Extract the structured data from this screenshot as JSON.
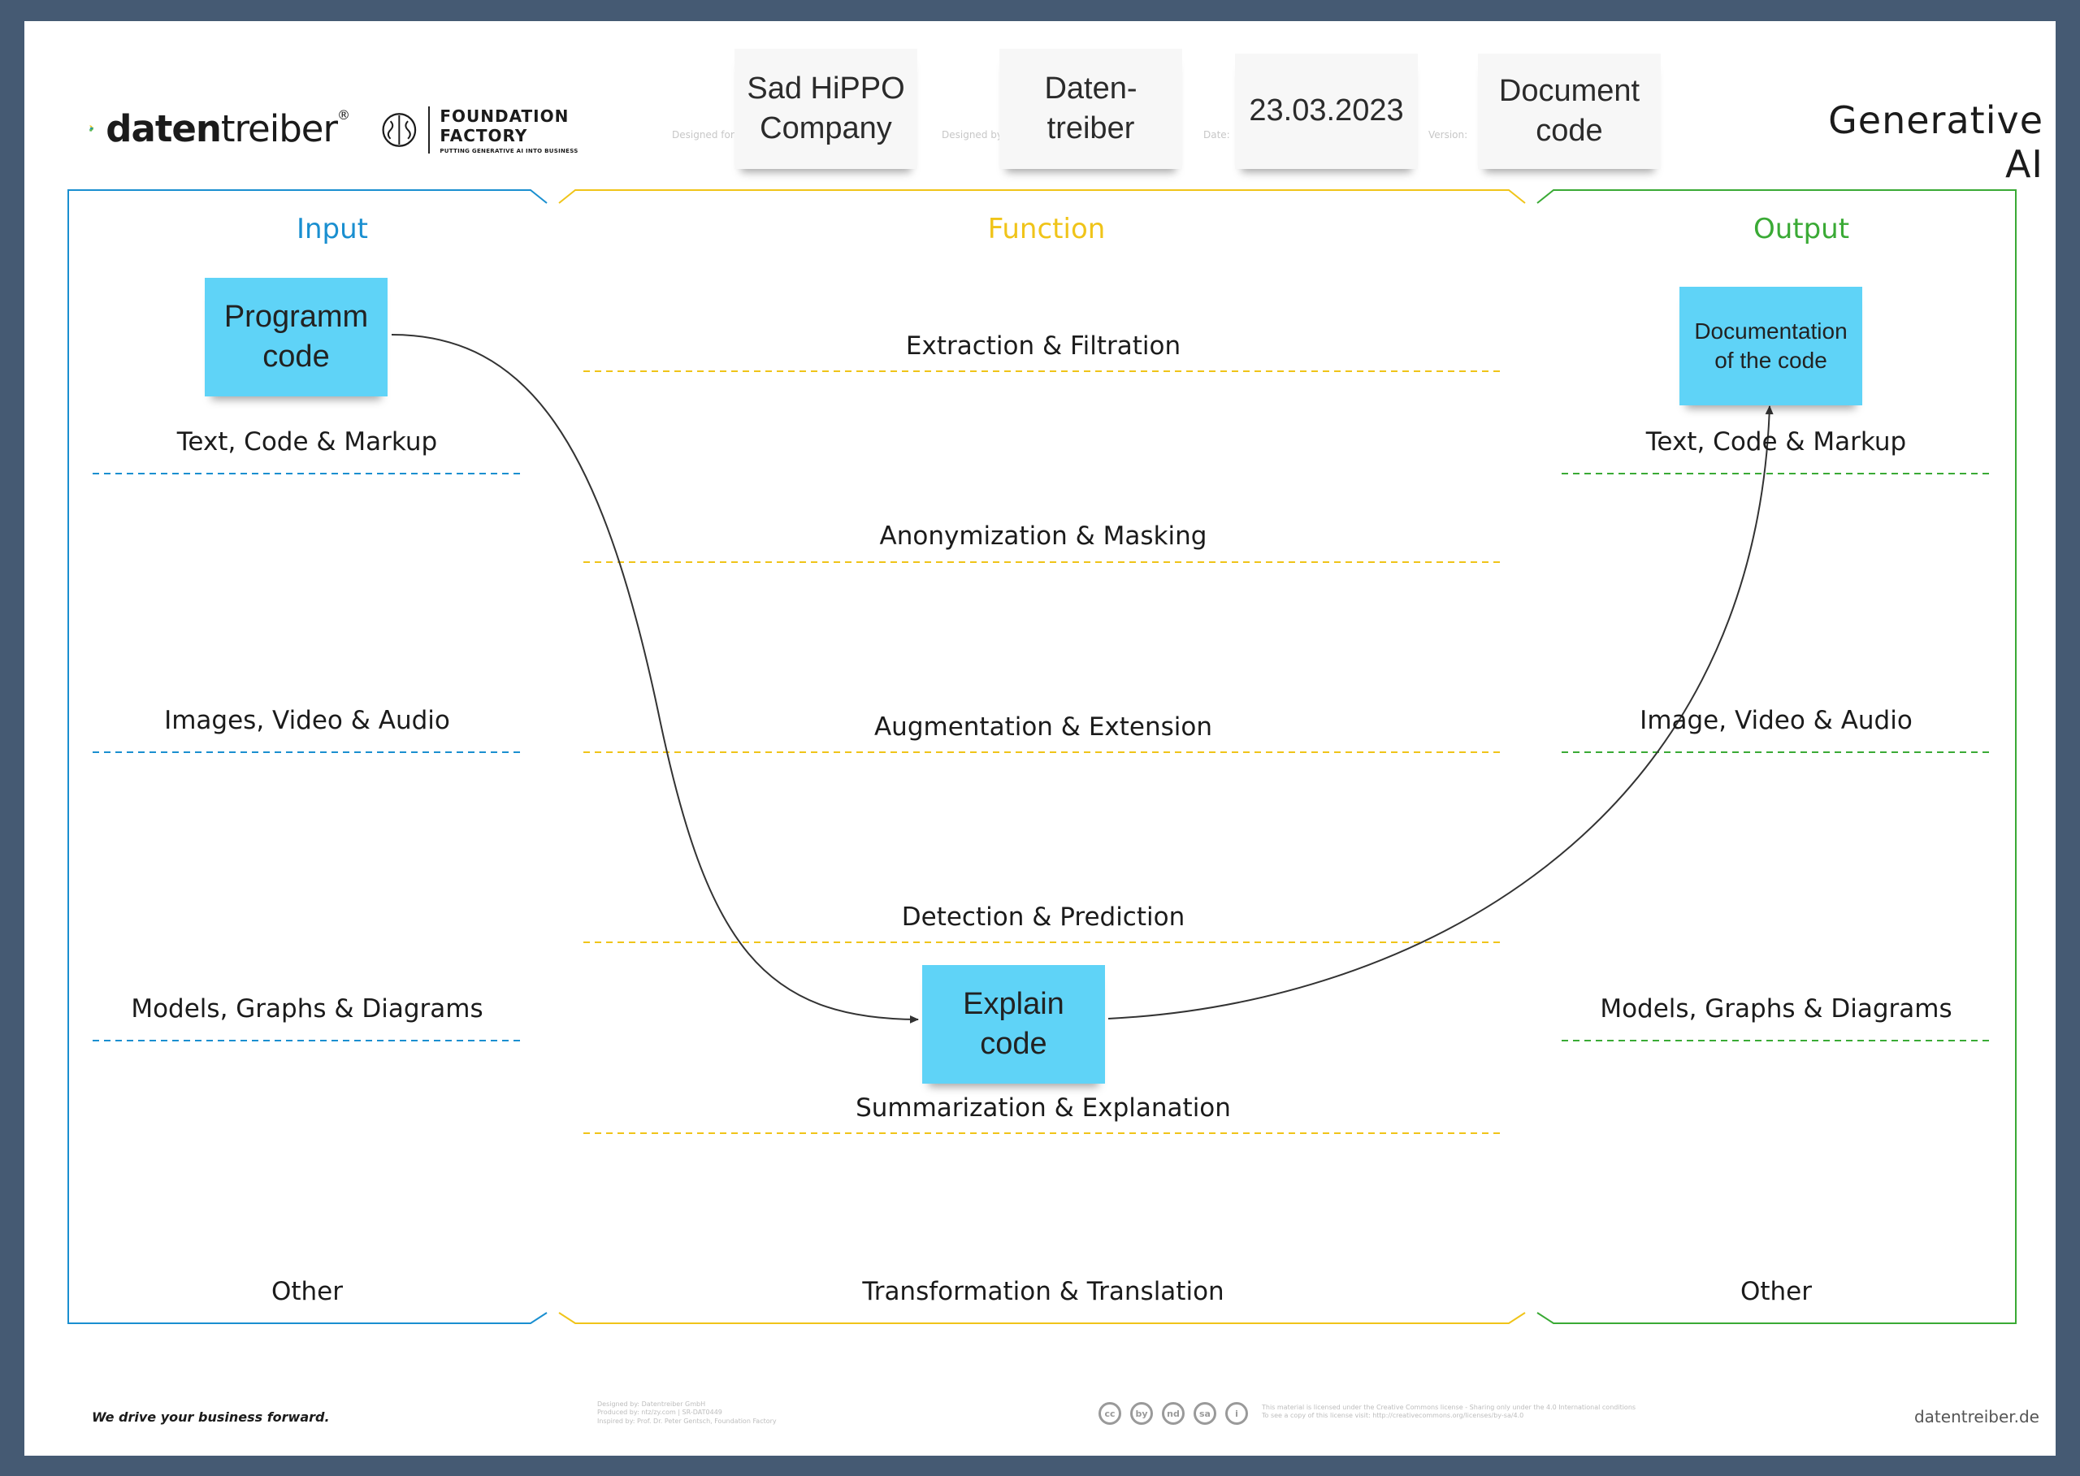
{
  "header": {
    "brand": {
      "prefix": "daten",
      "suffix": "treiber",
      "mark": "®"
    },
    "partner": {
      "name": "FOUNDATION FACTORY",
      "tagline": "PUTTING GENERATIVE AI INTO BUSINESS"
    },
    "fields": [
      {
        "label": "Designed for:",
        "value": "Sad HiPPO\nCompany"
      },
      {
        "label": "Designed by:",
        "value": "Daten-\ntreiber"
      },
      {
        "label": "Date:",
        "value": "23.03.2023"
      },
      {
        "label": "Version:",
        "value": "Document\ncode"
      }
    ],
    "title": "Generative AI"
  },
  "columns": {
    "input": {
      "heading": "Input",
      "color": "#1a8fd0",
      "rows": [
        "Text, Code & Markup",
        "Images, Video & Audio",
        "Models, Graphs & Diagrams",
        "Other"
      ]
    },
    "function": {
      "heading": "Function",
      "color": "#f0c419",
      "rows": [
        "Extraction & Filtration",
        "Anonymization & Masking",
        "Augmentation & Extension",
        "Detection & Prediction",
        "Summarization & Explanation",
        "Transformation & Translation"
      ]
    },
    "output": {
      "heading": "Output",
      "color": "#3aaa35",
      "rows": [
        "Text, Code & Markup",
        "Image, Video & Audio",
        "Models, Graphs & Diagrams",
        "Other"
      ]
    }
  },
  "stickies": {
    "input": "Programm\ncode",
    "function": "Explain\ncode",
    "output": "Documentation\nof the code"
  },
  "footer": {
    "slogan": "We drive your business forward.",
    "credits": [
      "Designed by: Datentreiber GmbH",
      "Produced by: ntz/zy.com | SR-DAT0449",
      "Inspired by: Prof. Dr. Peter Gentsch, Foundation Factory"
    ],
    "license": [
      "This material is licensed under the Creative Commons license - Sharing only under the 4.0 International conditions",
      "To see a copy of this license visit: http://creativecommons.org/licenses/by-sa/4.0"
    ],
    "cc_icons": [
      "cc",
      "by",
      "nd",
      "sa",
      "i"
    ],
    "site": "datentreiber.de"
  },
  "colors": {
    "input": "#1a8fd0",
    "function": "#f0c419",
    "output": "#3aaa35",
    "sticky": "#5fd3f7",
    "frame": "#455a73"
  },
  "icons": {
    "brand_logo": "chevron-logo-icon",
    "partner_logo": "brain-icon"
  }
}
